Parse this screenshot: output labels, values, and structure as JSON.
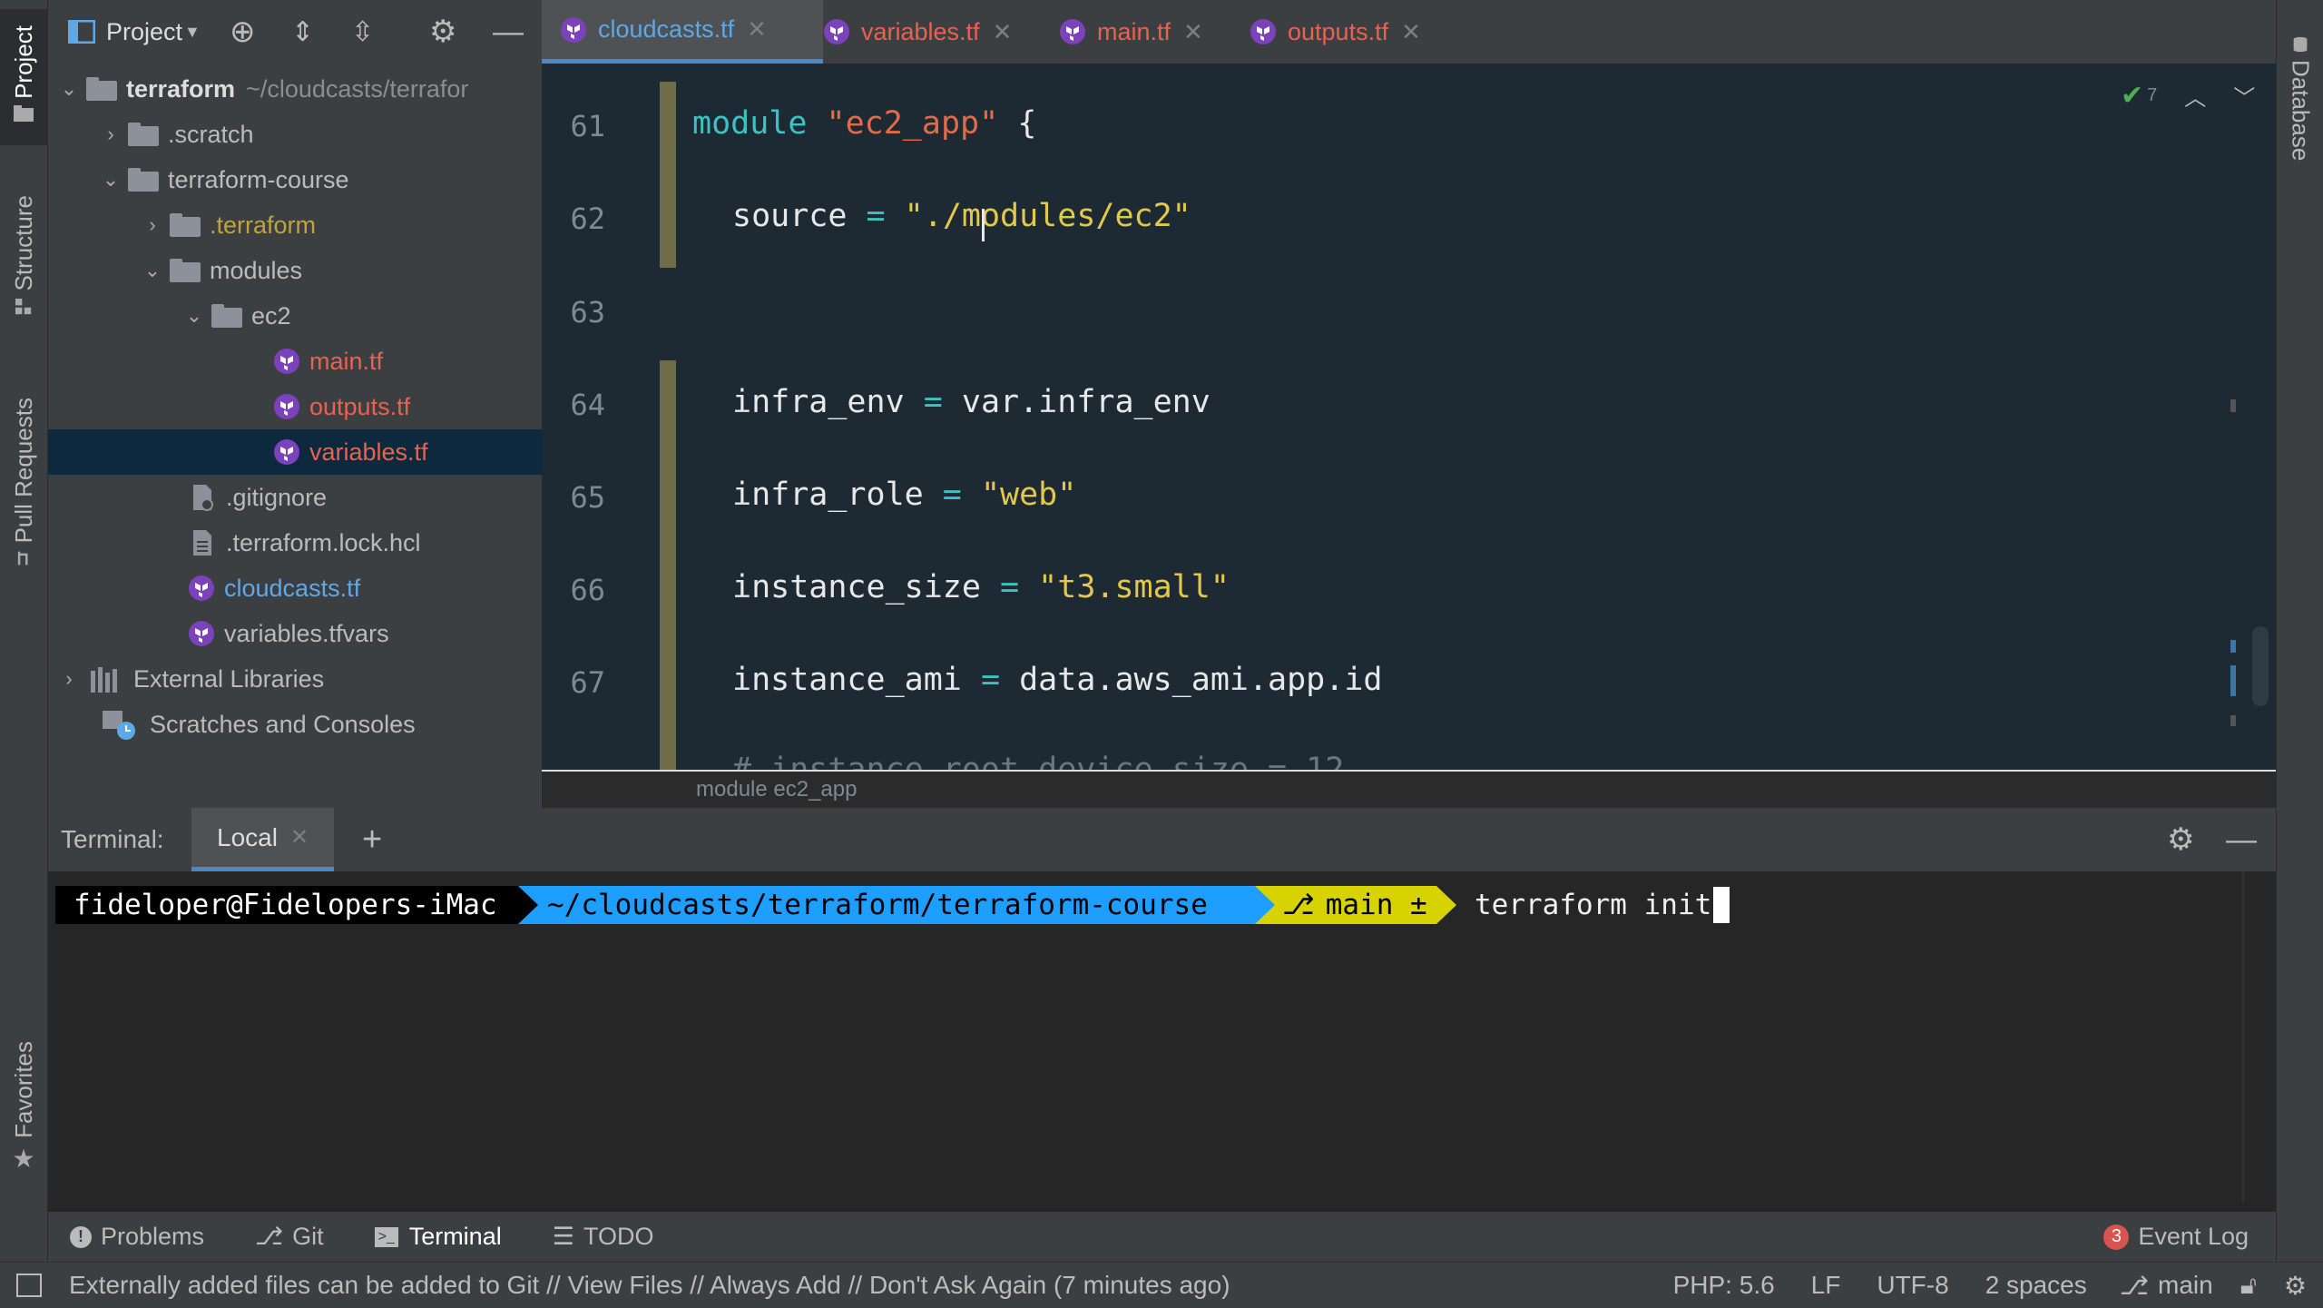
{
  "left_strip": {
    "project": "Project",
    "structure": "Structure",
    "pull_requests": "Pull Requests",
    "favorites": "Favorites"
  },
  "right_strip": {
    "database": "Database"
  },
  "project_panel": {
    "title": "Project",
    "tree": [
      {
        "label": "terraform",
        "extra": "~/cloudcasts/terrafor",
        "type": "folder",
        "expanded": true
      },
      {
        "label": ".scratch",
        "type": "folder",
        "expanded": false
      },
      {
        "label": "terraform-course",
        "type": "folder",
        "expanded": true
      },
      {
        "label": ".terraform",
        "type": "folder",
        "expanded": false
      },
      {
        "label": "modules",
        "type": "folder",
        "expanded": true
      },
      {
        "label": "ec2",
        "type": "folder",
        "expanded": true
      },
      {
        "label": "main.tf",
        "type": "tf"
      },
      {
        "label": "outputs.tf",
        "type": "tf"
      },
      {
        "label": "variables.tf",
        "type": "tf",
        "selected": true
      },
      {
        "label": ".gitignore",
        "type": "file"
      },
      {
        "label": ".terraform.lock.hcl",
        "type": "file"
      },
      {
        "label": "cloudcasts.tf",
        "type": "tf"
      },
      {
        "label": "variables.tfvars",
        "type": "tf"
      },
      {
        "label": "External Libraries",
        "type": "libs"
      },
      {
        "label": "Scratches and Consoles",
        "type": "scratch"
      }
    ]
  },
  "editor": {
    "tabs": [
      {
        "label": "cloudcasts.tf",
        "active": true
      },
      {
        "label": "variables.tf"
      },
      {
        "label": "main.tf"
      },
      {
        "label": "outputs.tf"
      }
    ],
    "inspection_count": "7",
    "line_numbers": [
      "61",
      "62",
      "63",
      "64",
      "65",
      "66",
      "67"
    ],
    "code": {
      "l61_kw": "module",
      "l61_str": "\"ec2_app\"",
      "l61_brace": "{",
      "l62_key": "source",
      "l62_eq": "=",
      "l62_str": "\"./modules/ec2\"",
      "l64_key": "infra_env",
      "l64_eq": "=",
      "l64_val": "var.infra_env",
      "l65_key": "infra_role",
      "l65_eq": "=",
      "l65_str": "\"web\"",
      "l66_key": "instance_size",
      "l66_eq": "=",
      "l66_str": "\"t3.small\"",
      "l67_key": "instance_ami",
      "l67_eq": "=",
      "l67_val": "data.aws_ami.app.id",
      "l68_partial": "# instance_root_device_size = 12"
    },
    "breadcrumb": "module ec2_app"
  },
  "terminal": {
    "title": "Terminal:",
    "tab": "Local",
    "prompt_user": "fideloper@Fidelopers-iMac",
    "prompt_path": "~/cloudcasts/terraform/terraform-course",
    "prompt_branch": "main ±",
    "command": "terraform init"
  },
  "tool_bar": {
    "problems": "Problems",
    "git": "Git",
    "terminal": "Terminal",
    "todo": "TODO",
    "event_log": "Event Log",
    "event_count": "3"
  },
  "status_bar": {
    "message": "Externally added files can be added to Git // View Files // Always Add // Don't Ask Again (7 minutes ago)",
    "php": "PHP: 5.6",
    "line_sep": "LF",
    "encoding": "UTF-8",
    "indent": "2 spaces",
    "branch": "main"
  },
  "colors": {
    "tf_purple": "#7b42bc",
    "modified_red": "#e8624f",
    "added_blue": "#5fa8e6",
    "ignored_yellow": "#bfa33c",
    "accent_blue": "#4a88c7"
  }
}
